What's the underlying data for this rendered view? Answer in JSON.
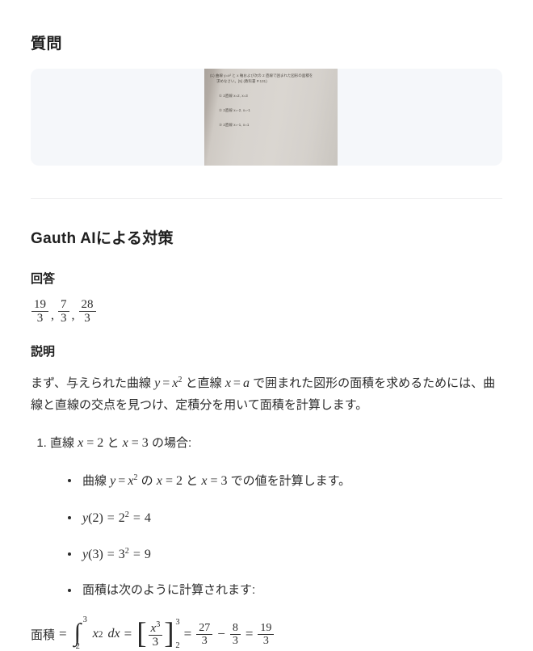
{
  "question": {
    "heading": "質問",
    "photo": {
      "lines": [
        "(1) 曲線 y=x² と x 軸および次の 2 直線で囲まれた図形の面積を",
        "求めなさい。[5] (教科書 P.131)",
        "① 2直線 x=2, x=3",
        "② 2直線 x=-2, x=-1",
        "③ 2直線 x=-1, x=1"
      ]
    }
  },
  "solution": {
    "heading": "Gauth AIによる対策",
    "answer_heading": "回答",
    "answer": {
      "fractions": [
        {
          "num": "19",
          "den": "3"
        },
        {
          "num": "7",
          "den": "3"
        },
        {
          "num": "28",
          "den": "3"
        }
      ],
      "separator": ","
    },
    "explanation_heading": "説明",
    "intro": {
      "t1": "まず、与えられた曲線 ",
      "m1_var": "y",
      "m1_eq": "=",
      "m1_x": "x",
      "m1_exp": "2",
      "t2": " と直線 ",
      "m2_x": "x",
      "m2_eq": "=",
      "m2_a": "a",
      "t3": " で囲まれた図形の面積を求めるためには、曲線と直線の交点を見つけ、定積分を用いて面積を計算します。"
    },
    "steps": [
      {
        "label_pre": "直線 ",
        "x1": "x",
        "eq1": "= 2",
        "mid": " と ",
        "x2": "x",
        "eq2": "= 3",
        "label_post": " の場合:",
        "bullets": [
          {
            "pre": "曲線 ",
            "y": "y",
            "eq": "=",
            "x": "x",
            "exp": "2",
            "mid1": " の ",
            "bx1": "x",
            "beq1": "= 2",
            "mid2": " と ",
            "bx2": "x",
            "beq2": "= 3",
            "post": " での値を計算します。"
          },
          {
            "math": "y(2) = 2² = 4",
            "fn": "y",
            "arg": "(2)",
            "eq1": "=",
            "base": "2",
            "exp": "2",
            "eq2": "=",
            "result": "4"
          },
          {
            "math": "y(3) = 3² = 9",
            "fn": "y",
            "arg": "(3)",
            "eq1": "=",
            "base": "3",
            "exp": "2",
            "eq2": "=",
            "result": "9"
          },
          {
            "text": "面積は次のように計算されます:"
          }
        ]
      }
    ],
    "formula": {
      "lhs": "面積",
      "eq1": "=",
      "integral": {
        "symbol": "∫",
        "lower": "2",
        "upper": "3",
        "integrand_x": "x",
        "integrand_exp": "2",
        "dx": "dx"
      },
      "eq2": "=",
      "bracket": {
        "open": "[",
        "close": "]",
        "num_x": "x",
        "num_exp": "3",
        "den": "3",
        "sub": "2",
        "sup": "3"
      },
      "eq3": "=",
      "f1": {
        "num": "27",
        "den": "3"
      },
      "minus": "−",
      "f2": {
        "num": "8",
        "den": "3"
      },
      "eq4": "=",
      "f3": {
        "num": "19",
        "den": "3"
      }
    }
  }
}
